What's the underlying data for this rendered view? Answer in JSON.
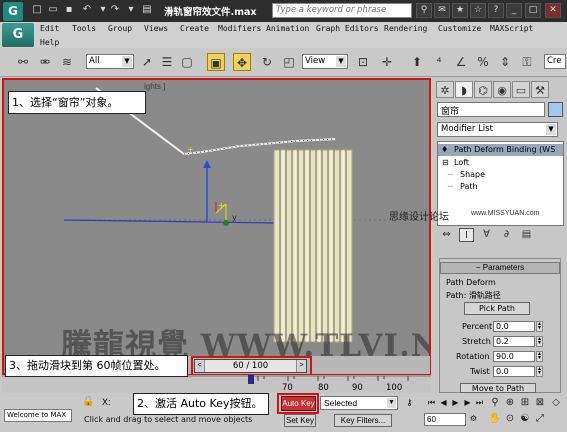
{
  "title_bar": {
    "title": "滑轨窗帘效文件.max",
    "search_placeholder": "Type a keyword or phrase"
  },
  "menu": {
    "items": [
      "Edit",
      "Tools",
      "Group",
      "Views",
      "Create",
      "Modifiers",
      "Animation",
      "Graph Editors",
      "Rendering",
      "Customize",
      "MAXScript",
      "Help"
    ]
  },
  "toolbar": {
    "filter_value": "All",
    "refcoord_value": "View"
  },
  "viewport": {
    "label": "ights ]",
    "callout1": "1、选择“窗帘”对象。",
    "watermark": "騰龍視覺 WWW.TLVI.NET"
  },
  "command_panel": {
    "object_name": "窗帘",
    "modifier_list_label": "Modifier List",
    "stack": [
      "Path Deform Binding (WS",
      "Loft",
      "Shape",
      "Path"
    ],
    "site_watermark": "思缘设计论坛",
    "site_watermark_url": "www.MISSYUAN.com",
    "rollout_title": "Parameters",
    "group_title": "Path Deform",
    "path_label": "Path: 滑轨路径",
    "pick_path_label": "Pick Path",
    "params": [
      {
        "label": "Percent",
        "value": "0.0"
      },
      {
        "label": "Stretch",
        "value": "0.2"
      },
      {
        "label": "Rotation",
        "value": "90.0"
      },
      {
        "label": "Twist",
        "value": "0.0"
      }
    ],
    "move_to_path_label": "Move to Path"
  },
  "timeline": {
    "frame_display": "60 / 100",
    "ticks": [
      "70",
      "80",
      "90",
      "100"
    ],
    "callout3": "3、拖动滑块到第 60帧位置处。"
  },
  "status": {
    "maxscript_text": "Welcome to MAX",
    "x_label": "X:",
    "prompt": "Click and drag to select and move objects",
    "callout2": "2、激活 Auto Key按钮。",
    "auto_key_label": "Auto Key",
    "set_key_label": "Set Key",
    "selected_value": "Selected",
    "key_filters_label": "Key Filters...",
    "current_frame": "60"
  },
  "colors": {
    "highlight_red": "#d01414",
    "auto_key_red": "#c93030",
    "viewport_bg": "#8a8a8a"
  }
}
